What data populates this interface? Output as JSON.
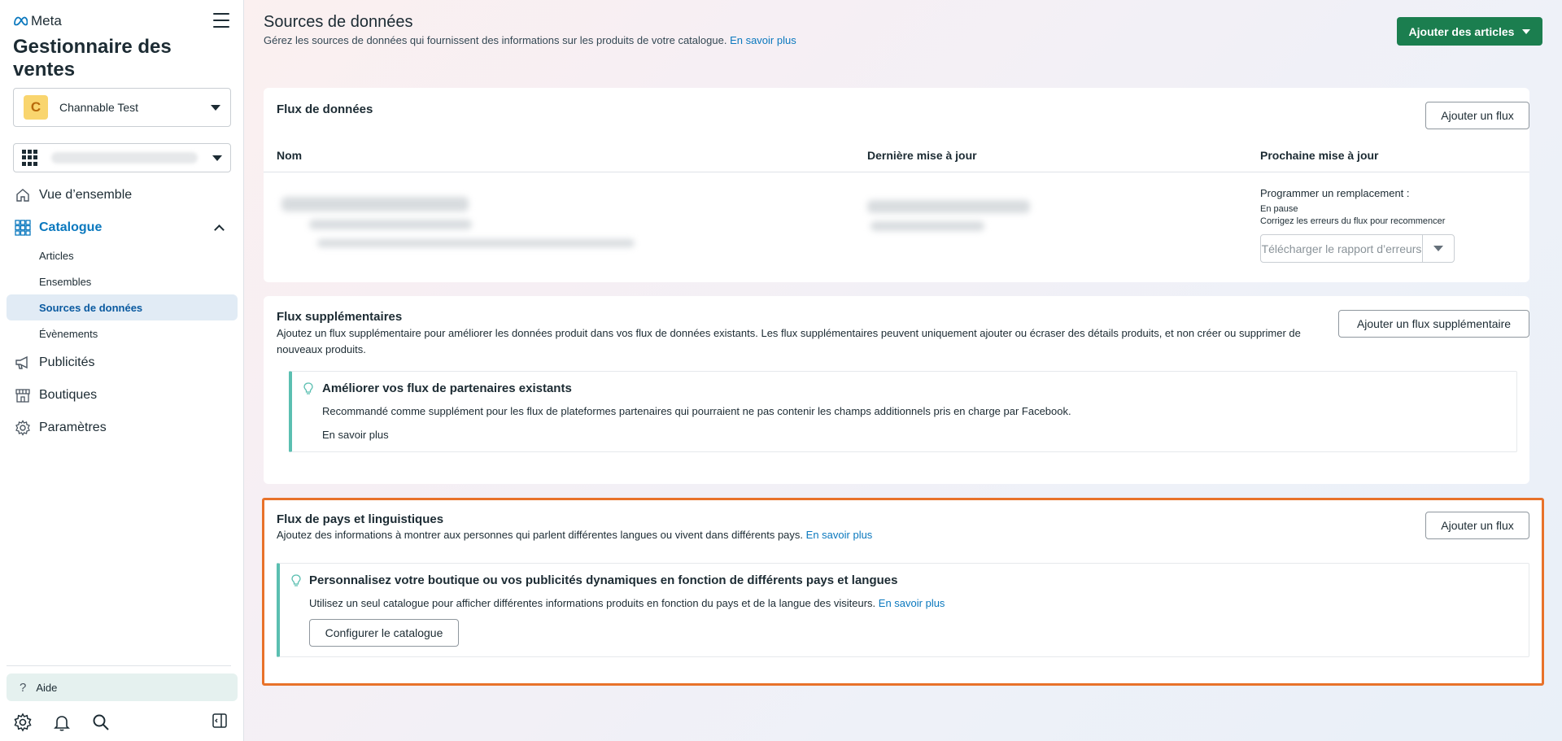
{
  "sidebar": {
    "brand": "Meta",
    "app_title": "Gestionnaire des ventes",
    "account": {
      "avatar_letter": "C",
      "name": "Channable Test"
    },
    "nav": {
      "overview": "Vue d’ensemble",
      "catalog": "Catalogue",
      "catalog_sub": {
        "articles": "Articles",
        "sets": "Ensembles",
        "data_sources": "Sources de données",
        "events": "Évènements"
      },
      "ads": "Publicités",
      "shops": "Boutiques",
      "settings": "Paramètres"
    },
    "help": "Aide"
  },
  "header": {
    "title": "Sources de données",
    "subtitle": "Gérez les sources de données qui fournissent des informations sur les produits de votre catalogue.",
    "learn_more": "En savoir plus",
    "add_items_button": "Ajouter des articles"
  },
  "data_feeds": {
    "title": "Flux de données",
    "add_button": "Ajouter un flux",
    "columns": [
      "Nom",
      "Dernière mise à jour",
      "Prochaine mise à jour"
    ],
    "schedule_label": "Programmer un remplacement :",
    "schedule_status": "En pause",
    "schedule_hint": "Corrigez les erreurs du flux pour recommencer",
    "download_errors_button": "Télécharger le rapport d’erreurs"
  },
  "supplementary_feeds": {
    "title": "Flux supplémentaires",
    "description": "Ajoutez un flux supplémentaire pour améliorer les données produit dans vos flux de données existants. Les flux supplémentaires peuvent uniquement ajouter ou écraser des détails produits, et non créer ou supprimer de nouveaux produits.",
    "add_button": "Ajouter un flux supplémentaire",
    "tip": {
      "title": "Améliorer vos flux de partenaires existants",
      "text": "Recommandé comme supplément pour les flux de plateformes partenaires qui pourraient ne pas contenir les champs additionnels pris en charge par Facebook.",
      "link": "En savoir plus"
    }
  },
  "country_language_feeds": {
    "title": "Flux de pays et linguistiques",
    "description": "Ajoutez des informations à montrer aux personnes qui parlent différentes langues ou vivent dans différents pays.",
    "learn_more": "En savoir plus",
    "add_button": "Ajouter un flux",
    "tip": {
      "title": "Personnalisez votre boutique ou vos publicités dynamiques en fonction de différents pays et langues",
      "text": "Utilisez un seul catalogue pour afficher différentes informations produits en fonction du pays et de la langue des visiteurs.",
      "link": "En savoir plus",
      "button": "Configurer le catalogue"
    }
  },
  "colors": {
    "primary_green": "#1b7e4f",
    "link_blue": "#0a78be",
    "tip_accent": "#5bbfb1",
    "highlight_orange": "#e8722a"
  },
  "icons": [
    "meta-logo-icon",
    "hamburger-icon",
    "grid-icon",
    "home-icon",
    "catalog-grid-icon",
    "chevron-up-icon",
    "megaphone-icon",
    "shop-icon",
    "gear-icon",
    "help-icon",
    "bell-icon",
    "search-icon",
    "panel-toggle-icon",
    "lightbulb-icon",
    "caret-down-icon"
  ]
}
